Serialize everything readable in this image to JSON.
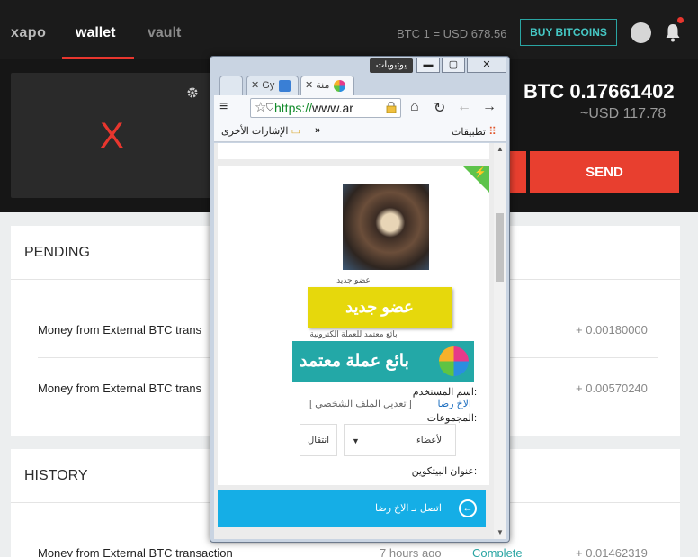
{
  "topbar": {
    "logo": "xapo",
    "nav": [
      "wallet",
      "vault"
    ],
    "rate": "BTC 1 = USD 678.56",
    "buy_label": "BUY BITCOINS"
  },
  "balance": {
    "card_mark": "X",
    "btc": "BTC 0.17661402",
    "usd": "~USD 117.78",
    "send_label": "SEND"
  },
  "pending": {
    "title": "PENDING",
    "rows": [
      {
        "desc": "Money from External BTC trans",
        "amount": "+ 0.00180000"
      },
      {
        "desc": "Money from External BTC trans",
        "amount": "+ 0.00570240"
      }
    ]
  },
  "history": {
    "title": "HISTORY",
    "rows": [
      {
        "desc": "Money from External BTC transaction",
        "time": "7 hours ago",
        "status": "Complete",
        "amount": "+ 0.01462319"
      }
    ]
  },
  "browser": {
    "window_label": "يوتيوبات",
    "tab2_label": "Gy",
    "tab3_label": "منة",
    "url_scheme": "https://",
    "url_host": "www.ar",
    "bookmarks_apps": "تطبيقات",
    "bookmarks_other": "الإشارات الأخرى",
    "bookmarks_more": "»"
  },
  "profile": {
    "rank_small_1": "عضو جديد",
    "rank_badge_1": "عضو جديد",
    "rank_small_2": "بائع معتمد للعملة الكترونية",
    "rank_badge_2": "بائع عملة معتمد",
    "username_label": "اسم المستخدم:",
    "username": "الاخ رضا",
    "edit_profile": "[ تعديل الملف الشخصي ]",
    "groups_label": "المجموعات:",
    "group_value": "الأعضاء",
    "move_label": "انتقال",
    "bitcoin_label": "عنوان البيتكوين:",
    "contact_label": "اتصل بـ الاخ رضا"
  },
  "colors": {
    "accent_red": "#e8362e",
    "teal": "#2aa5a3",
    "contact_blue": "#15aee6"
  }
}
